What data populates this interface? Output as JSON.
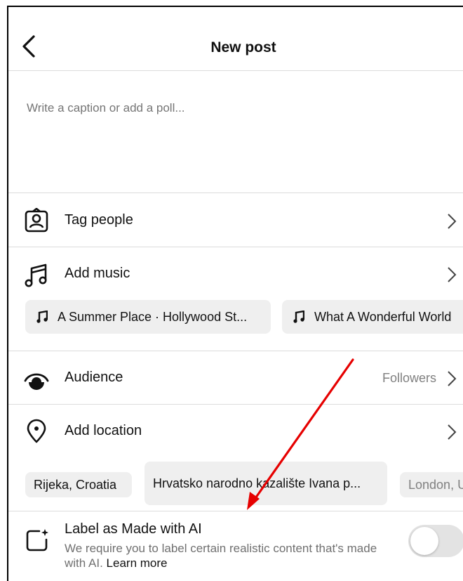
{
  "header": {
    "title": "New post"
  },
  "caption": {
    "placeholder": "Write a caption or add a poll..."
  },
  "rows": {
    "tag_people": {
      "label": "Tag people"
    },
    "add_music": {
      "label": "Add music"
    },
    "audience": {
      "label": "Audience",
      "value": "Followers"
    },
    "add_location": {
      "label": "Add location"
    }
  },
  "music_suggestions": [
    {
      "label": "A Summer Place · Hollywood St..."
    },
    {
      "label": "What A Wonderful World"
    }
  ],
  "location_suggestions": [
    {
      "label": "Rijeka, Croatia"
    },
    {
      "label": "Hrvatsko narodno kazalište Ivana p..."
    },
    {
      "label": "London, U"
    }
  ],
  "ai_label": {
    "title": "Label as Made with AI",
    "description": "We require you to label certain realistic content that's made with AI.",
    "learn_more": "Learn more",
    "enabled": false
  },
  "colors": {
    "annotation_arrow": "#e60000",
    "toggle_off": "#e3e3e3",
    "chip_bg": "#efefef"
  }
}
